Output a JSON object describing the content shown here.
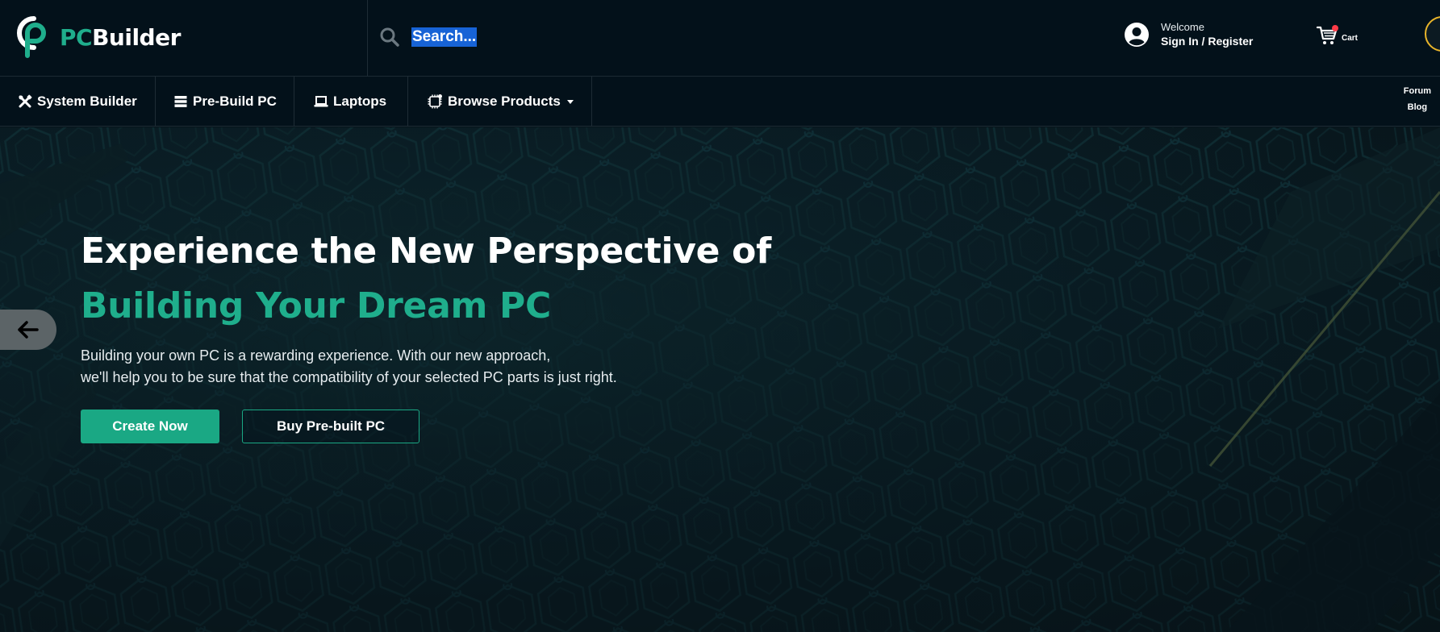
{
  "brand": {
    "pc": "PC",
    "builder": "Builder",
    "logo_color": "#1fae8c"
  },
  "search": {
    "placeholder": "Search..."
  },
  "account": {
    "welcome": "Welcome",
    "signin": "Sign In / Register"
  },
  "cart": {
    "label": "Cart"
  },
  "nav": {
    "items": [
      {
        "label": "System Builder",
        "icon": "tools-icon"
      },
      {
        "label": "Pre-Build PC",
        "icon": "server-icon"
      },
      {
        "label": "Laptops",
        "icon": "laptop-icon"
      },
      {
        "label": "Browse Products",
        "icon": "chip-icon"
      }
    ],
    "side_links": [
      "Forum",
      "Blog"
    ]
  },
  "hero": {
    "headline_line1": "Experience the New Perspective of",
    "headline_line2": "Building Your Dream PC",
    "desc_line1": "Building your own PC is a rewarding experience. With our new approach,",
    "desc_line2": "we'll help you to be sure that the compatibility of your selected PC parts is just right.",
    "primary_button": "Create Now",
    "secondary_button": "Buy Pre-built PC"
  },
  "colors": {
    "accent": "#1aa884",
    "header_bg": "#03111a",
    "hero_bg": "#0a1e26",
    "notification": "#ff3b47",
    "toggle_ring": "#e9b52a"
  }
}
